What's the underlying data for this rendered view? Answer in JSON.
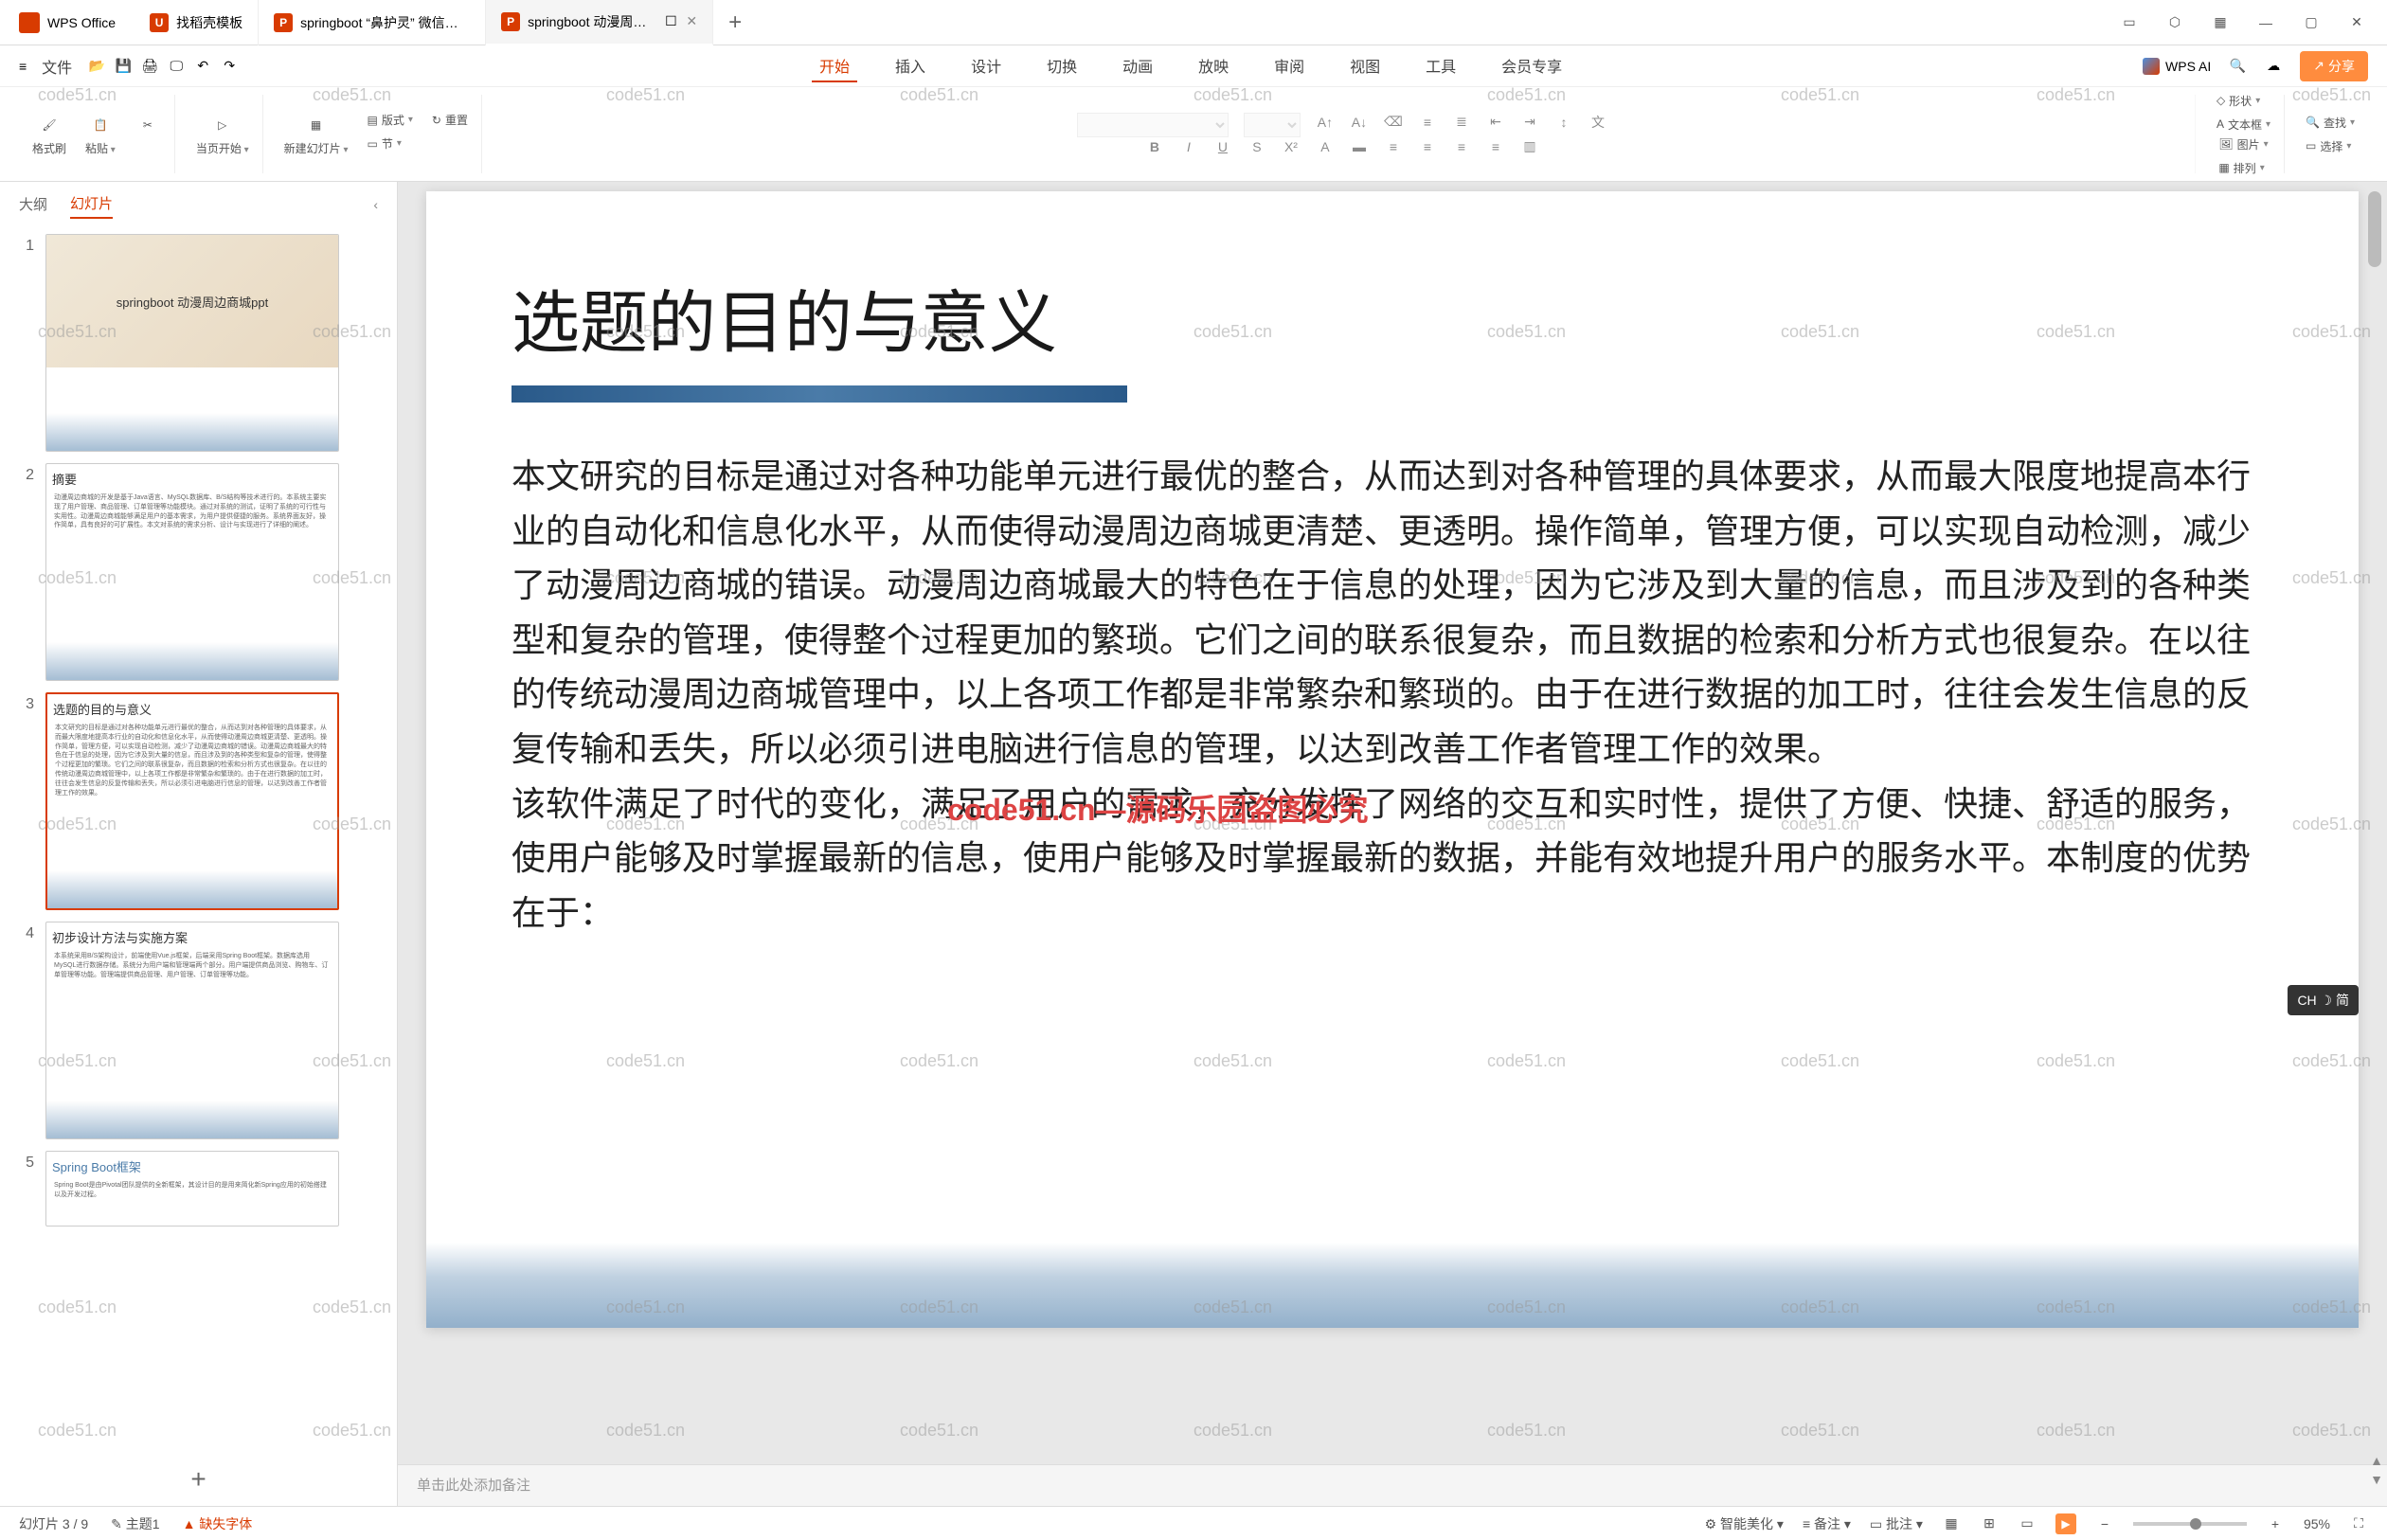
{
  "app": {
    "name": "WPS Office"
  },
  "tabs": [
    {
      "icon": "U",
      "label": "找稻壳模板"
    },
    {
      "icon": "P",
      "label": "springboot “鼻护灵” 微信小程序的"
    },
    {
      "icon": "P",
      "label": "springboot 动漫周边商城的",
      "active": true
    }
  ],
  "fileMenu": "文件",
  "menu": {
    "start": "开始",
    "insert": "插入",
    "design": "设计",
    "transition": "切换",
    "animation": "动画",
    "slideshow": "放映",
    "review": "审阅",
    "view": "视图",
    "tools": "工具",
    "member": "会员专享"
  },
  "wpsai": "WPS AI",
  "share": "分享",
  "ribbon": {
    "format_painter": "格式刷",
    "paste": "粘贴",
    "from_current": "当页开始",
    "new_slide": "新建幻灯片",
    "layout": "版式",
    "section": "节",
    "reset": "重置",
    "shapes": "形状",
    "picture": "图片",
    "textbox": "文本框",
    "arrange": "排列",
    "find": "查找",
    "select": "选择"
  },
  "sidebar": {
    "outline": "大纲",
    "slides": "幻灯片"
  },
  "thumbs": [
    {
      "n": "1",
      "title": "springboot 动漫周边商城ppt",
      "type": "cover"
    },
    {
      "n": "2",
      "title": "摘要",
      "type": "text"
    },
    {
      "n": "3",
      "title": "选题的目的与意义",
      "type": "text",
      "selected": true
    },
    {
      "n": "4",
      "title": "初步设计方法与实施方案",
      "type": "text"
    },
    {
      "n": "5",
      "title": "Spring Boot框架",
      "type": "text"
    }
  ],
  "slide": {
    "title": "选题的目的与意义",
    "p1": "本文研究的目标是通过对各种功能单元进行最优的整合，从而达到对各种管理的具体要求，从而最大限度地提高本行业的自动化和信息化水平，从而使得动漫周边商城更清楚、更透明。操作简单，管理方便，可以实现自动检测，减少了动漫周边商城的错误。动漫周边商城最大的特色在于信息的处理，因为它涉及到大量的信息，而且涉及到的各种类型和复杂的管理，使得整个过程更加的繁琐。它们之间的联系很复杂，而且数据的检索和分析方式也很复杂。在以往的传统动漫周边商城管理中，以上各项工作都是非常繁杂和繁琐的。由于在进行数据的加工时，往往会发生信息的反复传输和丢失，所以必须引进电脑进行信息的管理，以达到改善工作者管理工作的效果。",
    "p2": "该软件满足了时代的变化，满足了用户的需求，充分发挥了网络的交互和实时性，提供了方便、快捷、舒适的服务，使用户能够及时掌握最新的信息，使用户能够及时掌握最新的数据，并能有效地提升用户的服务水平。本制度的优势在于："
  },
  "notes_placeholder": "单击此处添加备注",
  "status": {
    "slide_pos": "幻灯片 3 / 9",
    "theme": "主题1",
    "missing_font": "缺失字体",
    "beautify": "智能美化",
    "notes": "备注",
    "comments": "批注",
    "zoom": "95%"
  },
  "ime": "CH ☽ 简",
  "watermark_red": "code51.cn—源码乐园盗图必究",
  "watermark_gray": "code51.cn"
}
